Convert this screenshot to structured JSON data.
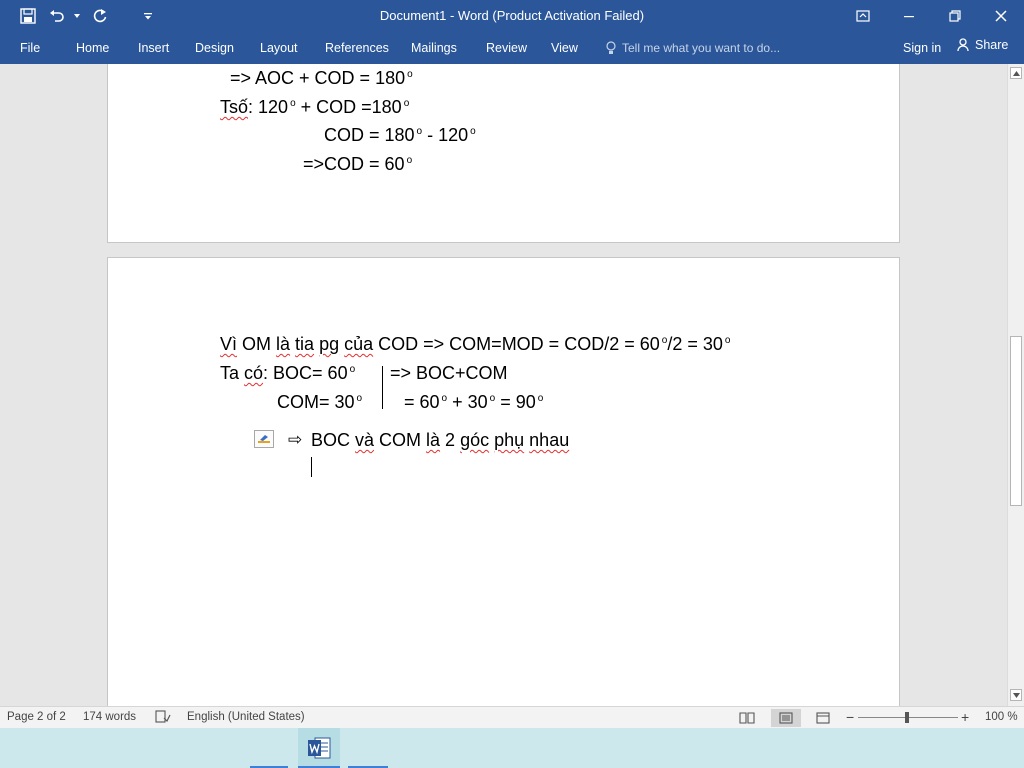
{
  "titlebar": {
    "title": "Document1 - Word (Product Activation Failed)"
  },
  "ribbon": {
    "file": "File",
    "tabs": [
      "Home",
      "Insert",
      "Design",
      "Layout",
      "References",
      "Mailings",
      "Review",
      "View"
    ],
    "tell_me": "Tell me what you want to do...",
    "sign_in": "Sign in",
    "share": "Share"
  },
  "page1": {
    "lines": {
      "l1": "=> AOC + COD = 180",
      "l2_pre": "Tsố",
      "l2_post": ": 120",
      "l2_mid": " + COD =180",
      "l3_a": "COD = 180",
      "l3_b": " - 120",
      "l4": "=>COD = 60"
    }
  },
  "page2": {
    "line1": {
      "a": "Vì",
      "b": " OM ",
      "c": "là",
      "d": " ",
      "e": "tia",
      "f": " ",
      "g": "pg",
      "h": " ",
      "i": "của",
      "j": " COD => COM=MOD = COD/2 = 60",
      "k": "/2 = 30"
    },
    "line2": {
      "a": "Ta ",
      "b": "có",
      "c": ": BOC= 60",
      "right": "=> BOC+COM"
    },
    "line3": {
      "left": "COM= 30",
      "r1": "= 60",
      "r2": " + 30",
      "r3": " = 90"
    },
    "line4": {
      "a": "BOC ",
      "b": "và",
      "c": " COM ",
      "d": "là",
      "e": " 2 ",
      "f": "góc",
      "g": " ",
      "h": "phụ",
      "i": " ",
      "j": "nhau"
    },
    "degree": "o"
  },
  "status": {
    "page": "Page 2 of 2",
    "words": "174 words",
    "language": "English (United States)",
    "zoom": "100 %",
    "zoom_level": 100
  }
}
